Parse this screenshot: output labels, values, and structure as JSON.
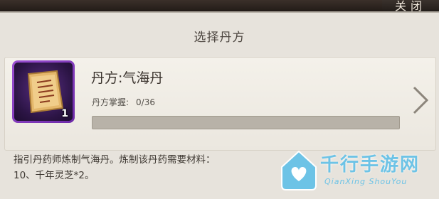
{
  "header": {
    "close_label": "关闭"
  },
  "panel": {
    "title": "选择丹方"
  },
  "recipe": {
    "name": "丹方:气海丹",
    "item_count": "1",
    "item_icon": "scroll-icon",
    "mastery_label": "丹方掌握:",
    "mastery_value": "0/36",
    "mastery_progress": 0,
    "description": "指引丹药师炼制气海丹。炼制该丹药需要材料：",
    "description_line2": "10、千年灵芝*2。"
  },
  "watermark": {
    "title": "千行手游网",
    "subtitle": "QianXing ShouYou"
  },
  "colors": {
    "item_frame": "#8e44c9",
    "panel_bg": "#e7e3dc",
    "watermark": "#6dc3e6"
  }
}
